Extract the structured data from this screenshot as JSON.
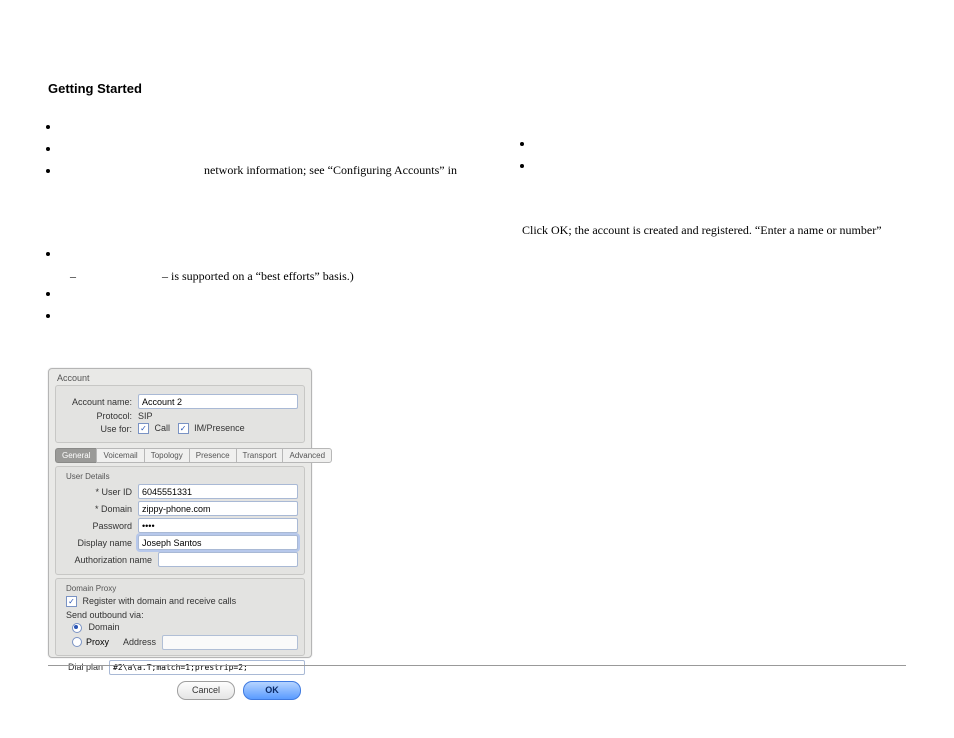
{
  "heading": "Getting Started",
  "col1_bullets_a": [
    "",
    "",
    ""
  ],
  "col1_text_a": "network information; see “Configuring Accounts” in ",
  "col1_bullets_b": [
    ""
  ],
  "col1_indent": "– is supported on a “best efforts” basis.)",
  "col1_bullets_c": [
    "",
    ""
  ],
  "col2_bullets": [
    "",
    ""
  ],
  "col2_para": "Click OK; the account is created and registered. “Enter a name or number” ",
  "dlg": {
    "title": "Account",
    "account_name_label": "Account name:",
    "account_name_value": "Account 2",
    "protocol_label": "Protocol:",
    "protocol_value": "SIP",
    "use_for_label": "Use for:",
    "call_label": "Call",
    "im_label": "IM/Presence",
    "call_checked": true,
    "im_checked": true,
    "tabs": [
      "General",
      "Voicemail",
      "Topology",
      "Presence",
      "Transport",
      "Advanced"
    ],
    "active_tab": 0,
    "userdetails_heading": "User Details",
    "user_id_label": "* User ID",
    "user_id_value": "6045551331",
    "domain_label": "* Domain",
    "domain_value": "zippy-phone.com",
    "password_label": "Password",
    "password_value": "••••",
    "display_name_label": "Display name",
    "display_name_value": "Joseph Santos",
    "auth_name_label": "Authorization name",
    "auth_name_value": "",
    "domain_proxy_heading": "Domain Proxy",
    "register_label": "Register with domain and receive calls",
    "register_checked": true,
    "send_label": "Send outbound via:",
    "opt_domain_label": "Domain",
    "opt_proxy_label": "Proxy",
    "opt_proxy_address_label": "Address",
    "opt_proxy_address_value": "",
    "selected_outbound": "domain",
    "dialplan_label": "Dial plan",
    "dialplan_value": "#2\\a\\a.T;match=1;prestrip=2;",
    "cancel": "Cancel",
    "ok": "OK"
  },
  "footer_link": ""
}
